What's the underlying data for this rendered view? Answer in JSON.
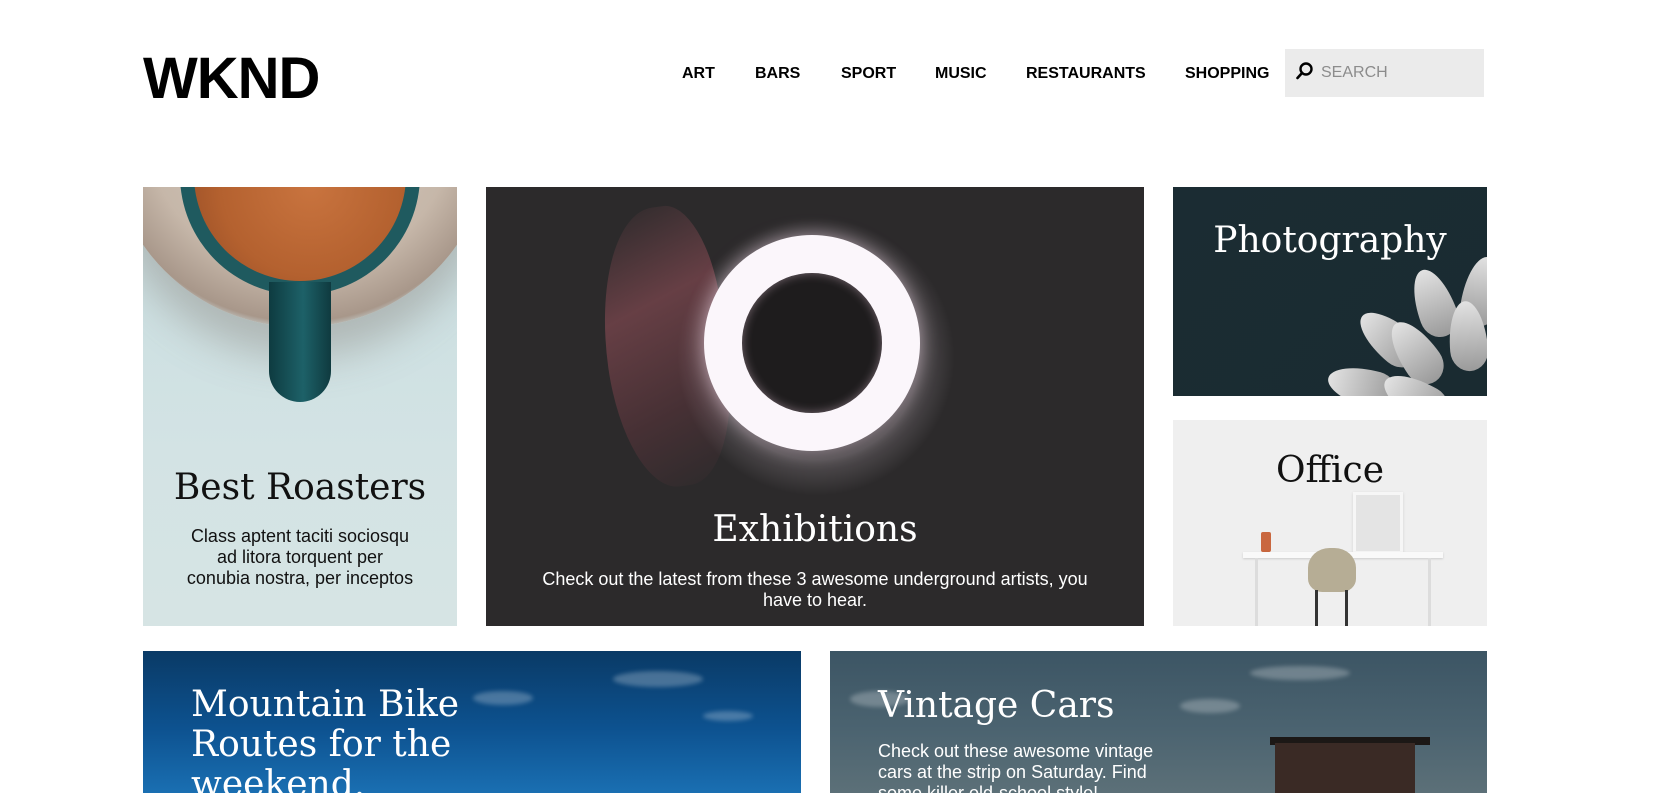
{
  "header": {
    "logo": "WKND",
    "nav": [
      "ART",
      "BARS",
      "SPORT",
      "MUSIC",
      "RESTAURANTS",
      "SHOPPING"
    ],
    "search": {
      "placeholder": "SEARCH",
      "icon": "search-icon"
    }
  },
  "tiles": {
    "roasters": {
      "title": "Best Roasters",
      "description": "Class aptent taciti sociosqu ad litora torquent per conubia nostra, per inceptos"
    },
    "exhibitions": {
      "title": "Exhibitions",
      "description": "Check out the latest from these 3 awesome underground artists, you have to hear."
    },
    "photography": {
      "title": "Photography"
    },
    "office": {
      "title": "Office"
    },
    "bike": {
      "title": "Mountain Bike Routes for the weekend."
    },
    "cars": {
      "title": "Vintage Cars",
      "description": "Check out these awesome vintage cars at the strip on Saturday. Find some killer old-school style!"
    }
  }
}
